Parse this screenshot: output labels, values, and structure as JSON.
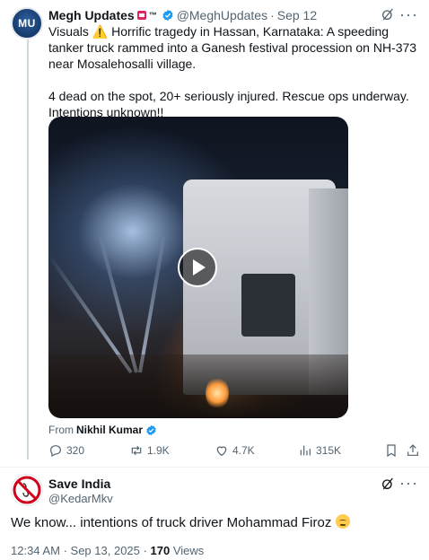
{
  "quoted_post": {
    "avatar_text": "MU",
    "author_name": "Megh Updates",
    "tm_mark": "™",
    "handle": "@MeghUpdates",
    "separator": "·",
    "date": "Sep 12",
    "text_line1": "Visuals ⚠️ Horrific tragedy in Hassan, Karnataka: A speeding tanker truck rammed into a Ganesh festival procession on NH-373 near Mosalehosalli village.",
    "text_line2": "4 dead on the spot, 20+ seriously injured. Rescue ops underway. Intentions unknown!!",
    "from_label": "From",
    "from_name": "Nikhil Kumar",
    "stats": {
      "replies": "320",
      "reposts": "1.9K",
      "likes": "4.7K",
      "views": "315K"
    }
  },
  "reply_post": {
    "author_name": "Save India",
    "handle": "@KedarMkv",
    "text": "We know... intentions of truck driver Mohammad Firoz",
    "time": "12:34 AM",
    "date": "Sep 13, 2025",
    "separator": "·",
    "views_count": "170",
    "views_label": "Views"
  },
  "icons": {
    "verified": "verified-badge-icon",
    "more": "more-options-icon",
    "grok": "grok-icon",
    "play": "play-icon",
    "reply": "reply-icon",
    "repost": "repost-icon",
    "like": "like-icon",
    "views": "views-icon",
    "bookmark": "bookmark-icon",
    "share": "share-icon"
  },
  "colors": {
    "verified_blue": "#1d9bf0",
    "text_primary": "#0f1419",
    "text_secondary": "#536471"
  }
}
